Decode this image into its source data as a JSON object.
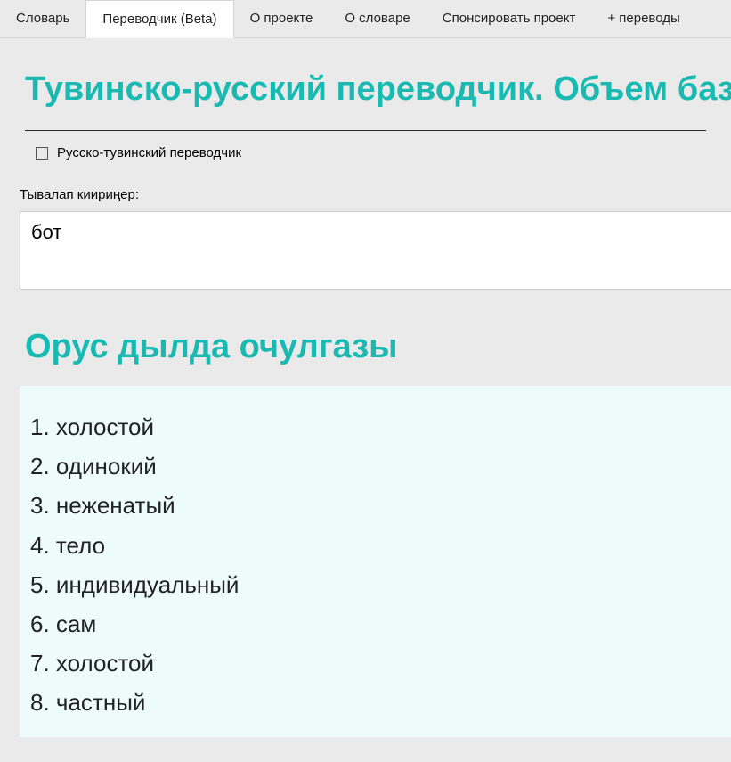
{
  "nav": {
    "items": [
      {
        "label": "Словарь",
        "active": false
      },
      {
        "label": "Переводчик (Beta)",
        "active": true
      },
      {
        "label": "О проекте",
        "active": false
      },
      {
        "label": "О словаре",
        "active": false
      },
      {
        "label": "Спонсировать проект",
        "active": false
      },
      {
        "label": "+ переводы",
        "active": false
      }
    ]
  },
  "page": {
    "title": "Тувинско-русский переводчик. Объем баз",
    "reverse_checkbox_label": "Русско-тувинский переводчик",
    "input_label": "Тывалап киириңер:",
    "input_value": "бот",
    "results_title": "Орус дылда очулгазы",
    "results": [
      "холостой",
      "одинокий",
      "неженатый",
      "тело",
      "индивидуальный",
      "сам",
      "холостой",
      "частный"
    ]
  }
}
